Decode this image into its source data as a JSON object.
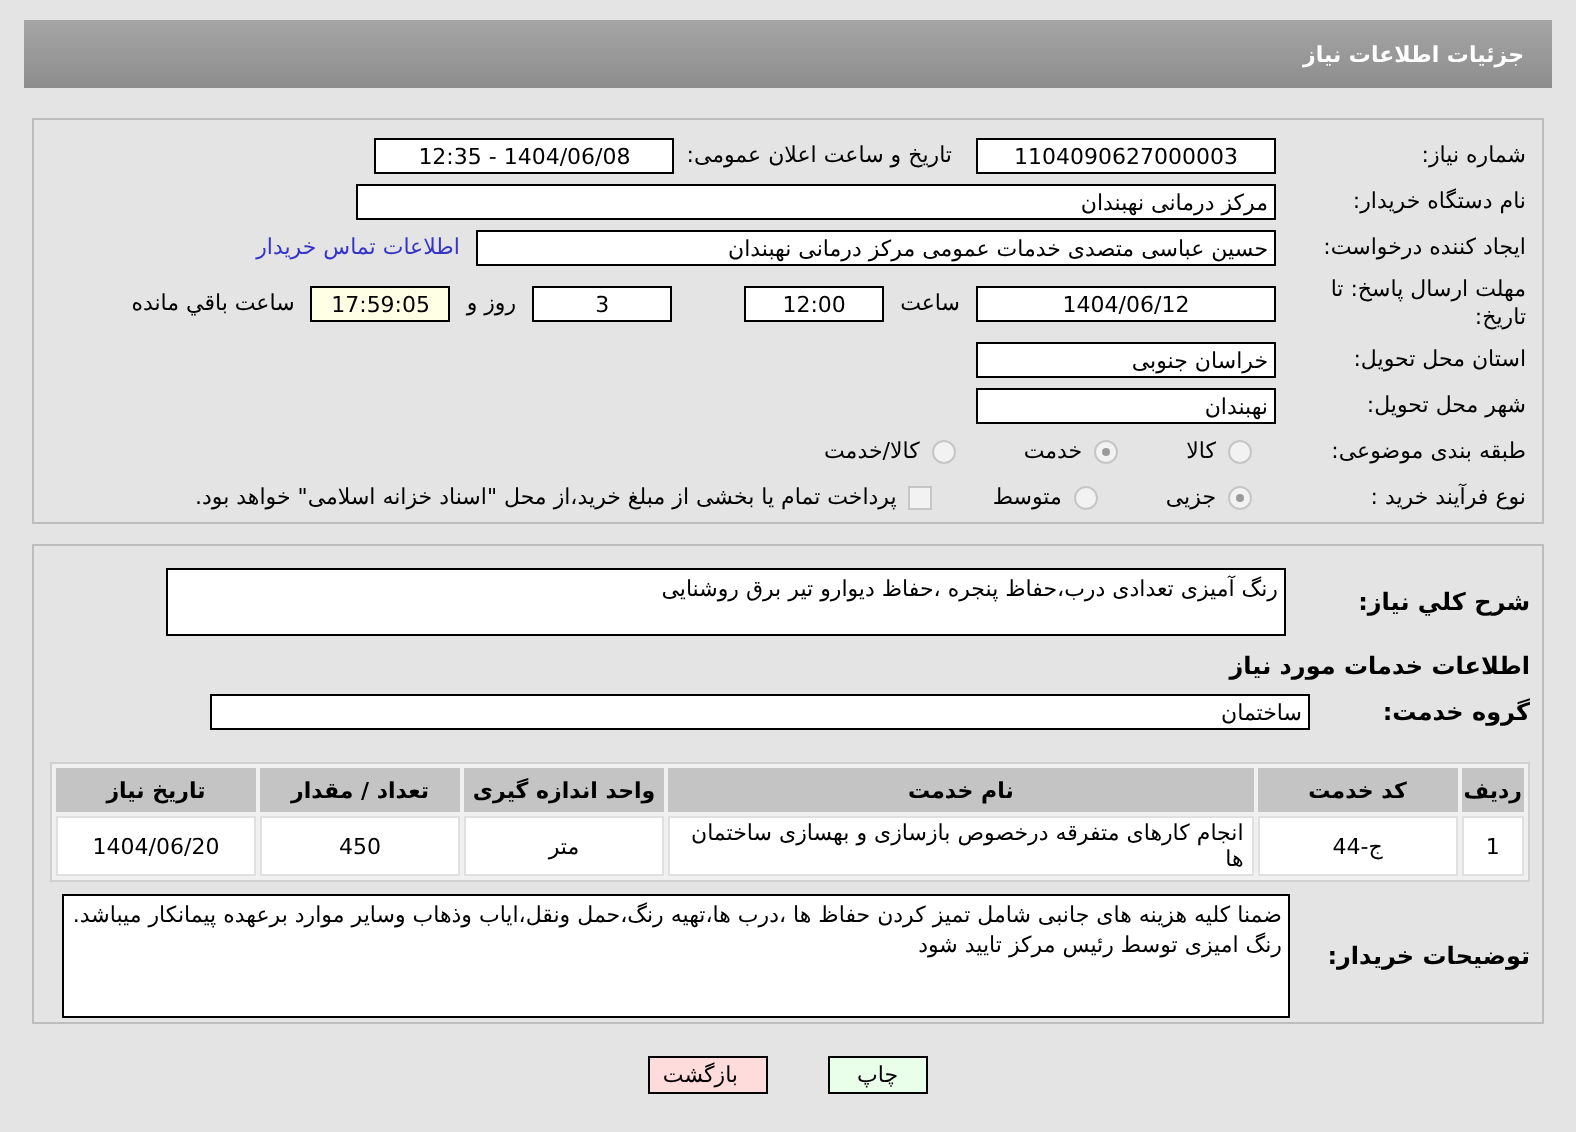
{
  "header": {
    "title": "جزئیات اطلاعات نیاز"
  },
  "need_number": {
    "label": "شماره نیاز:",
    "value": "1104090627000003"
  },
  "announce": {
    "label": "تاریخ و ساعت اعلان عمومی:",
    "value": "1404/06/08 - 12:35"
  },
  "buyer_org": {
    "label": "نام دستگاه خریدار:",
    "value": "مرکز درمانی نهبندان"
  },
  "requester": {
    "label": "ایجاد کننده درخواست:",
    "value": "حسین عباسی متصدی خدمات عمومی مرکز درمانی نهبندان",
    "link": "اطلاعات تماس خریدار"
  },
  "deadline": {
    "label": "مهلت ارسال پاسخ: تا تاریخ:",
    "date": "1404/06/12",
    "time_label": "ساعت",
    "time": "12:00",
    "days": "3",
    "days_label": "روز و",
    "remaining": "17:59:05",
    "remaining_label": "ساعت باقي مانده"
  },
  "province": {
    "label": "استان محل تحویل:",
    "value": "خراسان جنوبی"
  },
  "city": {
    "label": "شهر محل تحویل:",
    "value": "نهبندان"
  },
  "category": {
    "label": "طبقه بندی موضوعی:",
    "options": [
      {
        "label": "کالا",
        "selected": false
      },
      {
        "label": "خدمت",
        "selected": true
      },
      {
        "label": "کالا/خدمت",
        "selected": false
      }
    ]
  },
  "purchase_type": {
    "label": "نوع فرآیند خرید :",
    "options": [
      {
        "label": "جزیی",
        "selected": true
      },
      {
        "label": "متوسط",
        "selected": false
      }
    ],
    "treasury": {
      "checked": false,
      "text": "پرداخت تمام یا بخشی از مبلغ خرید،از محل \"اسناد خزانه اسلامی\" خواهد بود."
    }
  },
  "description": {
    "label": "شرح كلي نياز:",
    "value": "رنگ آمیزی تعدادی درب،حفاظ پنجره ،حفاظ دیوارو تیر برق روشنایی"
  },
  "services_title": "اطلاعات خدمات مورد نیاز",
  "service_group": {
    "label": "گروه خدمت:",
    "value": "ساختمان"
  },
  "table": {
    "columns": [
      "ردیف",
      "کد خدمت",
      "نام خدمت",
      "واحد اندازه گیری",
      "تعداد / مقدار",
      "تاریخ نیاز"
    ],
    "rows": [
      [
        "1",
        "ج-44",
        "انجام کارهای متفرقه درخصوص بازسازی و بهسازی ساختمان ها",
        "متر",
        "450",
        "1404/06/20"
      ]
    ]
  },
  "buyer_notes": {
    "label": "توضیحات خریدار:",
    "value": "ضمنا کلیه هزینه های جانبی شامل تمیز کردن حفاظ ها ،درب ها،تهیه رنگ،حمل ونقل،ایاب وذهاب وسایر موارد برعهده پیمانکار میباشد.\nرنگ امیزی توسط رئیس مرکز تایید شود"
  },
  "buttons": [
    {
      "label": "چاپ",
      "kind": "print"
    },
    {
      "label": "بازگشت",
      "kind": "back"
    }
  ]
}
